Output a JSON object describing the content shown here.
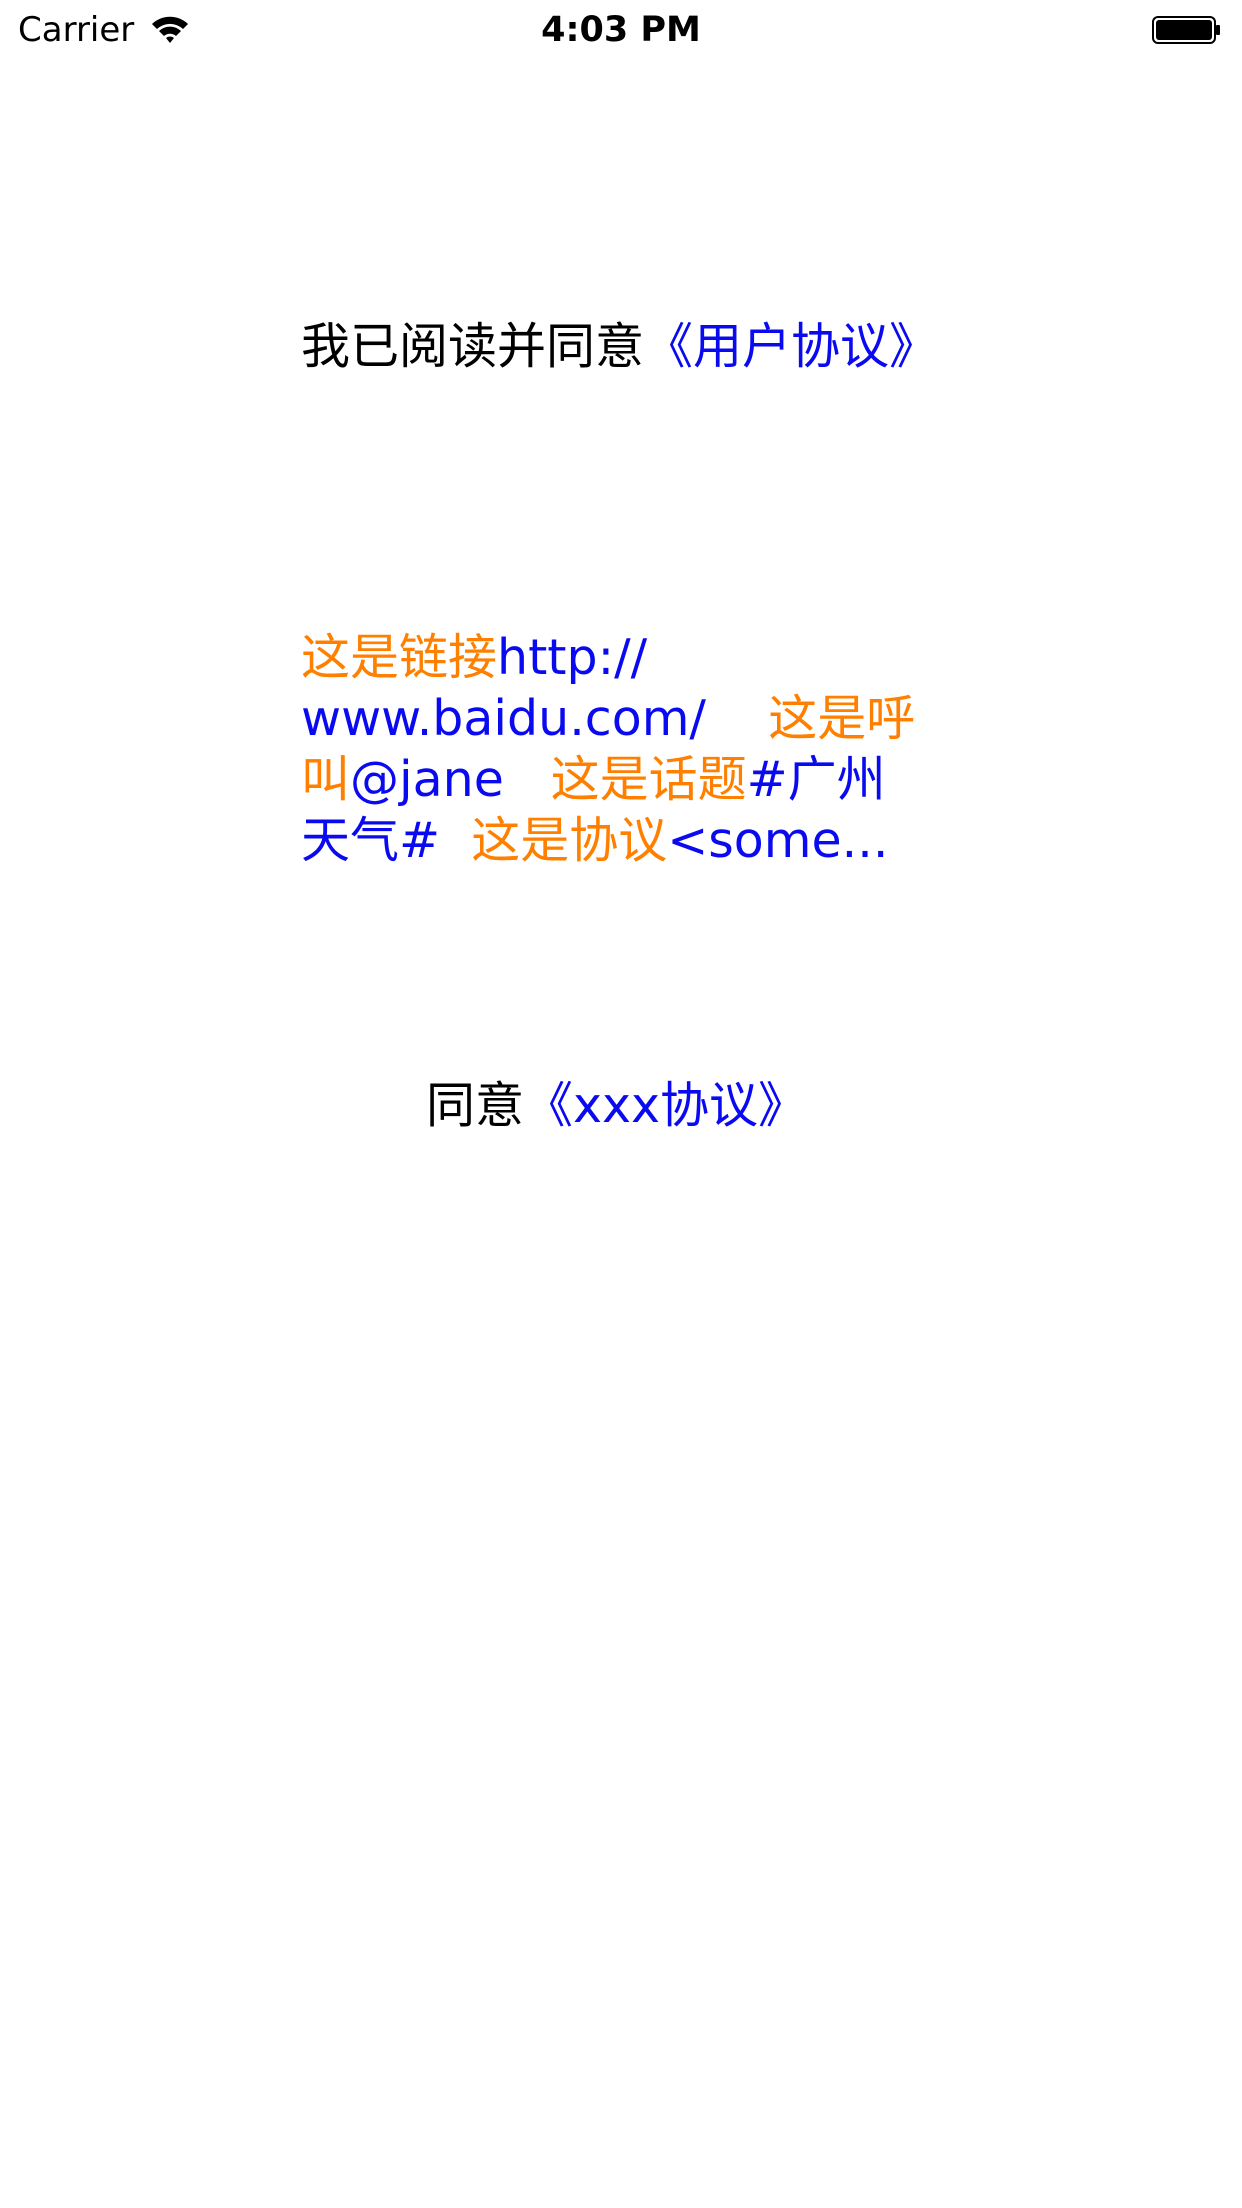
{
  "status_bar": {
    "carrier": "Carrier",
    "time": "4:03 PM"
  },
  "agree_label": {
    "prefix": "我已阅读并同意",
    "link": "《用户协议》"
  },
  "rich_label": {
    "lines": [
      [
        {
          "text": "这是链接",
          "style": "orange"
        },
        {
          "text": "http://",
          "style": "blue"
        }
      ],
      [
        {
          "text": "www.baidu.com/",
          "style": "blue"
        },
        {
          "text": "    这是呼",
          "style": "orange"
        }
      ],
      [
        {
          "text": "叫",
          "style": "orange"
        },
        {
          "text": "@jane",
          "style": "blue"
        },
        {
          "text": "   这是话题",
          "style": "orange"
        },
        {
          "text": "#广州",
          "style": "blue"
        }
      ],
      [
        {
          "text": "天气#",
          "style": "blue"
        },
        {
          "text": "  这是协议",
          "style": "orange"
        },
        {
          "text": "<some...",
          "style": "blue"
        }
      ]
    ]
  },
  "xxx_label": {
    "prefix": "同意",
    "link": "《xxx协议》"
  },
  "colors": {
    "link_blue": "#0a0af0",
    "highlight_orange": "#ff8000",
    "text_black": "#000000"
  }
}
